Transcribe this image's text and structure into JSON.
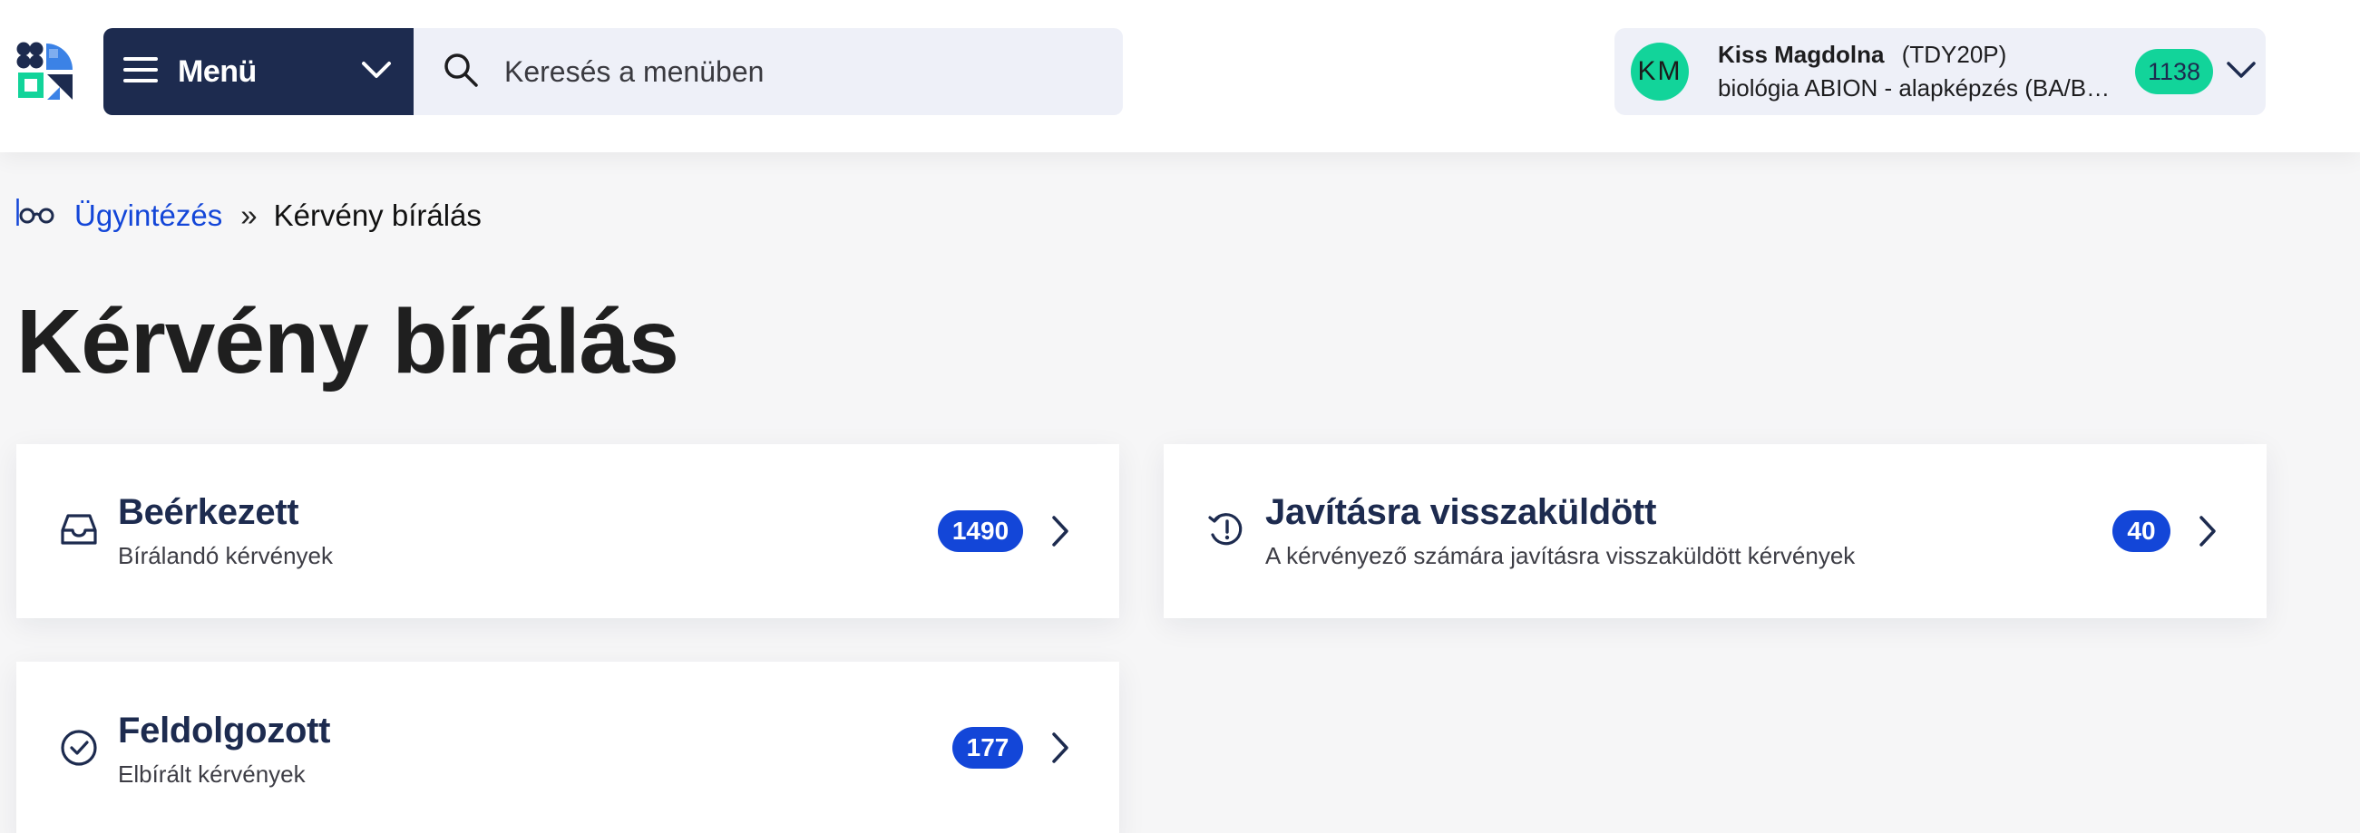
{
  "header": {
    "menu_label": "Menü",
    "search_placeholder": "Keresés a menüben",
    "user": {
      "initials": "KM",
      "name": "Kiss Magdolna",
      "code": "(TDY20P)",
      "program": "biológia ABION - alapképzés (BA/BSc/BProf) nappali",
      "count": "1138"
    }
  },
  "breadcrumb": {
    "parent": "Ügyintézés",
    "separator": "»",
    "current": "Kérvény bírálás"
  },
  "page_title": "Kérvény bírálás",
  "cards": [
    {
      "title": "Beérkezett",
      "subtitle": "Bírálandó kérvények",
      "count": "1490",
      "icon": "inbox-icon"
    },
    {
      "title": "Javításra visszaküldött",
      "subtitle": "A kérvényező számára javításra visszaküldött kérvények",
      "count": "40",
      "icon": "history-alert-icon"
    },
    {
      "title": "Feldolgozott",
      "subtitle": "Elbírált kérvények",
      "count": "177",
      "icon": "check-circle-icon"
    }
  ],
  "colors": {
    "navy": "#1d2b4f",
    "accent_blue": "#1346d8",
    "accent_green": "#12d49a",
    "panel_bg": "#eef0f8"
  }
}
